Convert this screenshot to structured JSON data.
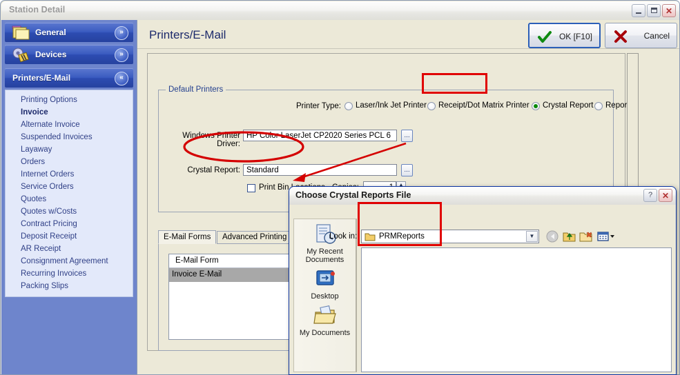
{
  "window": {
    "title": "Station Detail",
    "minimize_label": "Minimize",
    "maximize_label": "Maximize",
    "close_label": "Close"
  },
  "sidebar": {
    "sections": [
      {
        "label": "General",
        "icon": "folders-icon",
        "state": "collapsed",
        "chevron": "»"
      },
      {
        "label": "Devices",
        "icon": "gear-icon",
        "state": "collapsed",
        "chevron": "»"
      },
      {
        "label": "Printers/E-Mail",
        "icon": "none",
        "state": "expanded",
        "chevron": "«"
      }
    ],
    "items": [
      {
        "label": "Printing Options",
        "selected": false
      },
      {
        "label": "Invoice",
        "selected": true
      },
      {
        "label": "Alternate Invoice",
        "selected": false
      },
      {
        "label": "Suspended Invoices",
        "selected": false
      },
      {
        "label": "Layaway",
        "selected": false
      },
      {
        "label": "Orders",
        "selected": false
      },
      {
        "label": "Internet Orders",
        "selected": false
      },
      {
        "label": "Service Orders",
        "selected": false
      },
      {
        "label": "Quotes",
        "selected": false
      },
      {
        "label": "Quotes w/Costs",
        "selected": false
      },
      {
        "label": "Contract Pricing",
        "selected": false
      },
      {
        "label": "Deposit Receipt",
        "selected": false
      },
      {
        "label": "AR Receipt",
        "selected": false
      },
      {
        "label": "Consignment Agreement",
        "selected": false
      },
      {
        "label": "Recurring Invoices",
        "selected": false
      },
      {
        "label": "Packing Slips",
        "selected": false
      }
    ]
  },
  "header": {
    "page_title": "Printers/E-Mail",
    "ok_label": "OK [F10]",
    "cancel_label": "Cancel"
  },
  "default_printers": {
    "legend": "Default Printers",
    "printer_type_label": "Printer Type:",
    "printer_types": [
      {
        "label": "Laser/Ink Jet Printer",
        "selected": false
      },
      {
        "label": "Receipt/Dot Matrix Printer",
        "selected": false
      },
      {
        "label": "Crystal Report",
        "selected": true
      },
      {
        "label": "Reporter",
        "selected": false
      }
    ],
    "driver_label": "Windows Printer Driver:",
    "driver_value": "HP Color LaserJet CP2020 Series PCL 6",
    "driver_browse_label": "...",
    "crystal_report_label": "Crystal Report:",
    "crystal_report_value": "Standard",
    "crystal_browse_label": "...",
    "print_bin_label": "Print Bin Locations",
    "print_bin_checked": false,
    "copies_label": "Copies:",
    "copies_value": "1"
  },
  "tabs": [
    {
      "label": "E-Mail Forms",
      "active": true
    },
    {
      "label": "Advanced Printing",
      "active": false
    }
  ],
  "email_forms": {
    "column_header": "E-Mail Form",
    "rows": [
      {
        "label": "Invoice E-Mail",
        "selected": true
      }
    ]
  },
  "dialog": {
    "title": "Choose Crystal Reports File",
    "help_label": "?",
    "close_label": "Close",
    "look_in_label": "Look in:",
    "look_in_value": "PRMReports",
    "combo_arrow": "▼",
    "toolbar": [
      {
        "name": "back-icon",
        "label": "Back",
        "enabled": false
      },
      {
        "name": "up-folder-icon",
        "label": "Up One Level",
        "enabled": true
      },
      {
        "name": "new-folder-icon",
        "label": "Create New Folder",
        "enabled": true
      },
      {
        "name": "views-icon",
        "label": "Views",
        "enabled": true
      }
    ],
    "places": [
      {
        "label": "My Recent Documents",
        "icon": "recent-documents-icon"
      },
      {
        "label": "Desktop",
        "icon": "desktop-icon"
      },
      {
        "label": "My Documents",
        "icon": "my-documents-icon"
      }
    ],
    "file_list_items": []
  },
  "annotations": {
    "color": "#e00000",
    "shapes": [
      {
        "type": "rect",
        "target": "crystal-report-radio"
      },
      {
        "type": "ellipse",
        "target": "crystal-report-field"
      },
      {
        "type": "arrow",
        "target": "look-in-combo"
      },
      {
        "type": "rect",
        "target": "look-in-combo"
      }
    ]
  }
}
